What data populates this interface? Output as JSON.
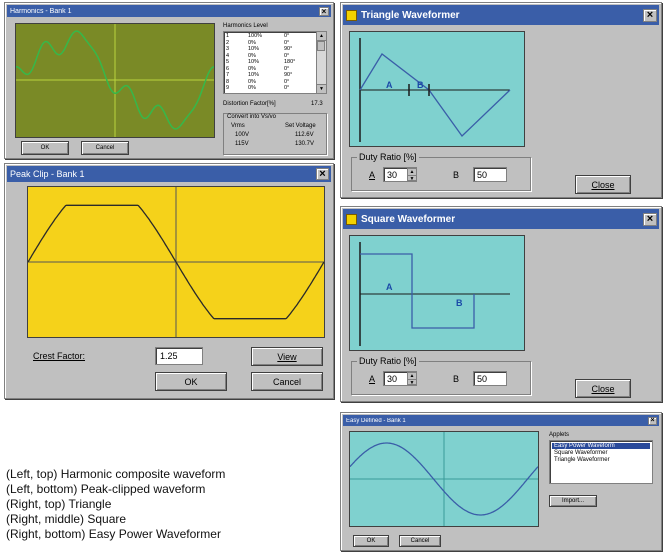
{
  "harmonics": {
    "title": "Harmonics - Bank 1",
    "list_header": "Harmonics Level",
    "rows": [
      {
        "n": "1",
        "pct": "100%",
        "deg": "0°"
      },
      {
        "n": "2",
        "pct": "0%",
        "deg": "0°"
      },
      {
        "n": "3",
        "pct": "10%",
        "deg": "90°"
      },
      {
        "n": "4",
        "pct": "0%",
        "deg": "0°"
      },
      {
        "n": "5",
        "pct": "10%",
        "deg": "180°"
      },
      {
        "n": "6",
        "pct": "0%",
        "deg": "0°"
      },
      {
        "n": "7",
        "pct": "10%",
        "deg": "90°"
      },
      {
        "n": "8",
        "pct": "0%",
        "deg": "0°"
      },
      {
        "n": "9",
        "pct": "0%",
        "deg": "0°"
      }
    ],
    "distortion_label": "Distortion Factor[%]",
    "distortion_value": "17.3",
    "convert_label": "Convert into Vs/vo",
    "vrms_header": "Vrms",
    "set_voltage_header": "Set Voltage",
    "v1_vrms": "100V",
    "v1_set": "112.6V",
    "v2_vrms": "115V",
    "v2_set": "130.7V",
    "ok": "OK",
    "cancel": "Cancel"
  },
  "peak_clip": {
    "title": "Peak Clip - Bank 1",
    "crest_label": "Crest Factor:",
    "crest_value": "1.25",
    "view": "View",
    "ok": "OK",
    "cancel": "Cancel"
  },
  "triangle": {
    "title": "Triangle Waveformer",
    "label_a": "A",
    "label_b": "B",
    "duty_label": "Duty Ratio [%]",
    "field_a_label": "A",
    "field_a_value": "30",
    "field_b_label": "B",
    "field_b_value": "50",
    "close": "Close"
  },
  "square": {
    "title": "Square Waveformer",
    "label_a": "A",
    "label_b": "B",
    "duty_label": "Duty Ratio [%]",
    "field_a_label": "A",
    "field_a_value": "30",
    "field_b_label": "B",
    "field_b_value": "50",
    "close": "Close"
  },
  "easy": {
    "title": "Easy Defined - Bank 1",
    "applets_label": "Applets",
    "applets": [
      "Easy Power Waveform",
      "Square Waveformer",
      "Triangle Waveformer"
    ],
    "import": "Import...",
    "ok": "OK",
    "cancel": "Cancel"
  },
  "captions": [
    "(Left, top)  Harmonic composite waveform",
    "(Left, bottom)  Peak-clipped waveform",
    "(Right, top)  Triangle",
    "(Right, middle)  Square",
    "(Right, bottom)  Easy Power Waveformer"
  ],
  "colors": {
    "title_bar": "#3a5ea8",
    "harmonics_plot_bg": "#7a8a26",
    "harmonics_wave": "#36b84a",
    "peak_bg": "#f5d21a",
    "peak_wave": "#2a2a2a",
    "cyan_bg": "#7fd1cf",
    "wave_blue": "#3a5ea8"
  }
}
